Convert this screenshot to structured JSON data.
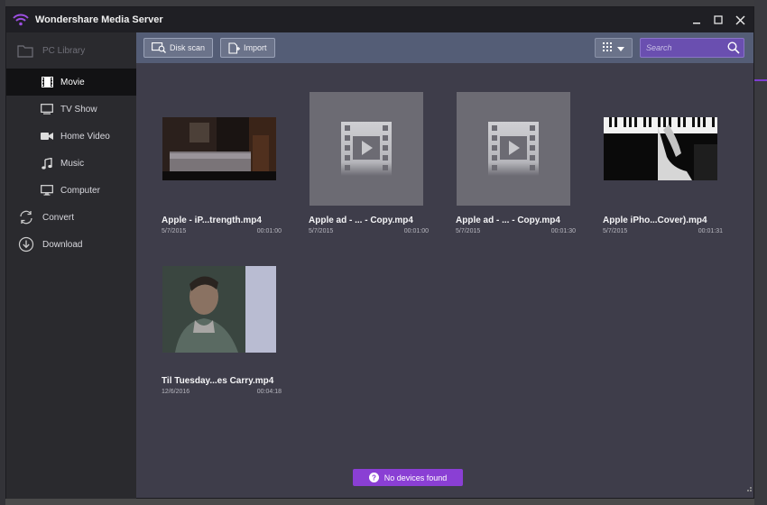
{
  "app": {
    "title": "Wondershare Media Server"
  },
  "sidebar": {
    "header": {
      "label": "PC Library",
      "icon": "folder-icon"
    },
    "items": [
      {
        "label": "Movie",
        "icon": "film-icon",
        "active": true
      },
      {
        "label": "TV Show",
        "icon": "tv-icon",
        "active": false
      },
      {
        "label": "Home Video",
        "icon": "video-camera-icon",
        "active": false
      },
      {
        "label": "Music",
        "icon": "music-note-icon",
        "active": false
      },
      {
        "label": "Computer",
        "icon": "monitor-icon",
        "active": false
      }
    ],
    "actions": [
      {
        "label": "Convert",
        "icon": "convert-icon"
      },
      {
        "label": "Download",
        "icon": "download-icon"
      }
    ]
  },
  "toolbar": {
    "disk_scan": "Disk scan",
    "import": "Import",
    "search_placeholder": "Search"
  },
  "videos": [
    {
      "name": "Apple - iP...trength.mp4",
      "date": "5/7/2015",
      "duration": "00:01:00",
      "thumb": "bedroom-scene"
    },
    {
      "name": "Apple ad - ... - Copy.mp4",
      "date": "5/7/2015",
      "duration": "00:01:00",
      "thumb": "placeholder"
    },
    {
      "name": "Apple ad - ... - Copy.mp4",
      "date": "5/7/2015",
      "duration": "00:01:30",
      "thumb": "placeholder"
    },
    {
      "name": "Apple iPho...Cover).mp4",
      "date": "5/7/2015",
      "duration": "00:01:31",
      "thumb": "piano-scene"
    },
    {
      "name": "Til Tuesday...es Carry.mp4",
      "date": "12/6/2016",
      "duration": "00:04:18",
      "thumb": "portrait-scene"
    }
  ],
  "status": {
    "label": "No devices found"
  },
  "colors": {
    "accent": "#8a3fd4",
    "toolbar": "#545d76",
    "sidebar": "#2a2a2e",
    "content": "#3e3d4a"
  }
}
